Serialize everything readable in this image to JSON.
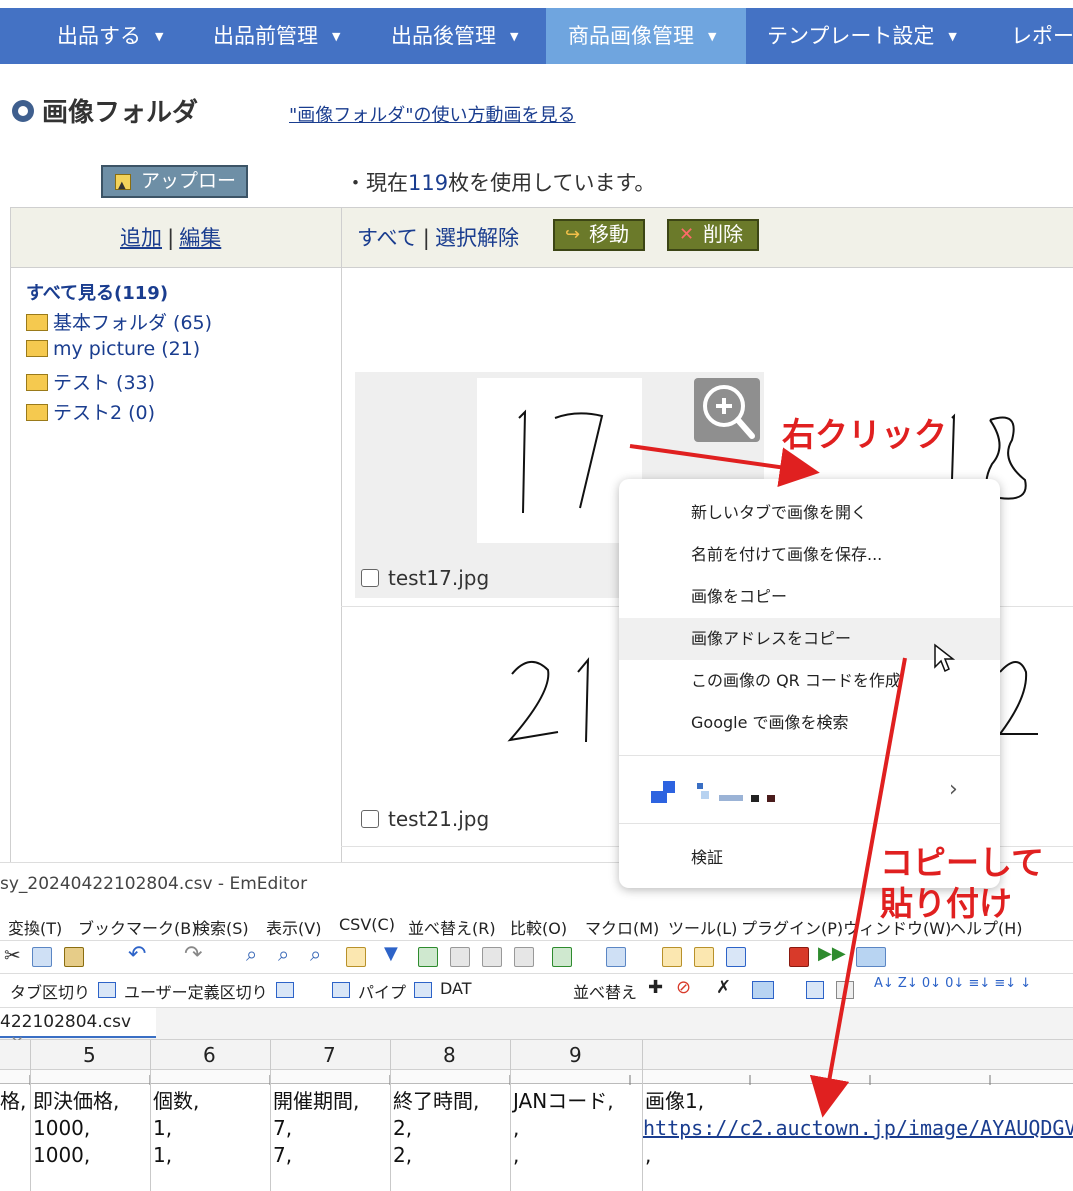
{
  "nav": {
    "items": [
      {
        "label": "出品する"
      },
      {
        "label": "出品前管理"
      },
      {
        "label": "出品後管理"
      },
      {
        "label": "商品画像管理"
      },
      {
        "label": "テンプレート設定"
      },
      {
        "label": "レポー"
      }
    ],
    "caret": "▼",
    "active_index": 3
  },
  "header": {
    "title": "画像フォルダ",
    "howto_link": "\"画像フォルダ\"の使い方動画を見る"
  },
  "upload": {
    "label": "アップロード"
  },
  "usage": {
    "prefix": "・現在",
    "count": "119",
    "suffix": "枚を使用しています。"
  },
  "table_header": {
    "add": "追加",
    "sep": "|",
    "edit": "編集",
    "all": "すべて",
    "deselect": "選択解除",
    "move": "移動",
    "delete": "削除"
  },
  "sidebar": {
    "all_label": "すべて見る(119)",
    "folders": [
      {
        "label": "基本フォルダ (65)"
      },
      {
        "label": "my picture (21)"
      },
      {
        "label": "テスト (33)"
      },
      {
        "label": "テスト2 (0)"
      }
    ]
  },
  "images": [
    {
      "name": "test17.jpg",
      "digits": "17"
    },
    {
      "name": "test21.jpg",
      "digits": "21"
    }
  ],
  "annotations": {
    "right_click": "右クリック",
    "copy_paste_line1": "コピーして",
    "copy_paste_line2": "貼り付け"
  },
  "context_menu": {
    "items": [
      {
        "label": "新しいタブで画像を開く"
      },
      {
        "label": "名前を付けて画像を保存..."
      },
      {
        "label": "画像をコピー"
      },
      {
        "label": "画像アドレスをコピー"
      },
      {
        "label": "この画像の QR コードを作成"
      },
      {
        "label": "Google で画像を検索"
      }
    ],
    "submenu_arrow": "›",
    "inspect": "検証",
    "highlighted_index": 3
  },
  "emeditor": {
    "title": "sy_20240422102804.csv - EmEditor",
    "menu": [
      {
        "label": "変換(T)"
      },
      {
        "label": "ブックマーク(B)"
      },
      {
        "label": "検索(S)"
      },
      {
        "label": "表示(V)"
      },
      {
        "label": "CSV(C)"
      },
      {
        "label": "並べ替え(R)"
      },
      {
        "label": "比較(O)"
      },
      {
        "label": "マクロ(M)"
      },
      {
        "label": "ツール(L)"
      },
      {
        "label": "プラグイン(P)"
      },
      {
        "label": "ウィンドウ(W)"
      },
      {
        "label": "ヘルプ(H)"
      }
    ],
    "toolbar2": {
      "tab_split": "タブ区切り",
      "user_split": "ユーザー定義区切り",
      "pipe": "パイプ",
      "dat": "DAT",
      "sort": "並べ替え"
    },
    "file_tab": {
      "label": "422102804.csv",
      "close": "×"
    },
    "columns": [
      "5",
      "6",
      "7",
      "8",
      "9"
    ],
    "rows": [
      [
        "格,",
        "即決価格,",
        "個数,",
        "開催期間,",
        "終了時間,",
        "JANコード,",
        "画像1,"
      ],
      [
        "",
        "1000,",
        "1,",
        "7,",
        "2,",
        ",",
        "https://c2.auctown.jp/image/AYAUQDGV"
      ],
      [
        "",
        "1000,",
        "1,",
        "7,",
        "2,",
        ",",
        ","
      ]
    ]
  }
}
